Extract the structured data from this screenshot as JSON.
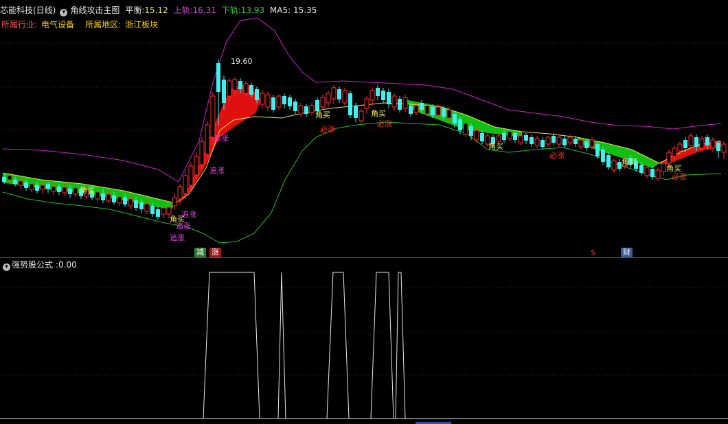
{
  "header": {
    "title": "芯能科技(日线)",
    "indicator_name": "角线攻击主图",
    "ping_label": "平衡:",
    "ping_value": "15.12",
    "upper_label": "上轨:",
    "upper_value": "16.31",
    "lower_label": "下轨:",
    "lower_value": "13.93",
    "ma_label": "MA5:",
    "ma_value": "15.35"
  },
  "info": {
    "industry_label": "所属行业:",
    "industry_value": "电气设备",
    "region_label": "所属地区:",
    "region_value": "浙江板块"
  },
  "main_chart": {
    "peak_label": "19.60",
    "signals": [
      {
        "text": "角买"
      },
      {
        "text": "追涨"
      },
      {
        "text": "追涨"
      },
      {
        "text": "追涨"
      },
      {
        "text": "追涨"
      },
      {
        "text": "角买"
      },
      {
        "text": "追涨"
      },
      {
        "text": "角买"
      },
      {
        "text": "必涨"
      },
      {
        "text": "角买"
      },
      {
        "text": "必涨"
      },
      {
        "text": "角买"
      },
      {
        "text": "必涨"
      },
      {
        "text": "角买"
      },
      {
        "text": "角买"
      },
      {
        "text": "必涨"
      }
    ],
    "bottom_markers": [
      {
        "text": "减",
        "color": "#2d7d2d"
      },
      {
        "text": "涨",
        "color": "#a01818"
      },
      {
        "text": "$",
        "color": "#ff3030"
      },
      {
        "text": "财",
        "color": "#3a5a9a"
      }
    ]
  },
  "sub_chart": {
    "title": "强势股公式",
    "value_label": ":0.00",
    "chart_data": {
      "type": "line",
      "ylim": [
        0,
        1
      ],
      "series": [
        {
          "values": [
            0,
            0,
            0,
            0,
            1,
            1,
            1,
            0,
            0,
            1,
            0,
            0,
            1,
            1,
            0,
            0,
            1,
            1,
            0,
            1,
            0,
            0
          ]
        }
      ]
    }
  },
  "colors": {
    "upper_band": "#d020d0",
    "lower_band": "#20c020",
    "middle_line": "#e8e850",
    "bull_fill": "#e01010",
    "bear_fill": "#10c010",
    "candle_up": "#ff3030",
    "candle_down": "#40f0f0",
    "grid": "#7a1010"
  }
}
